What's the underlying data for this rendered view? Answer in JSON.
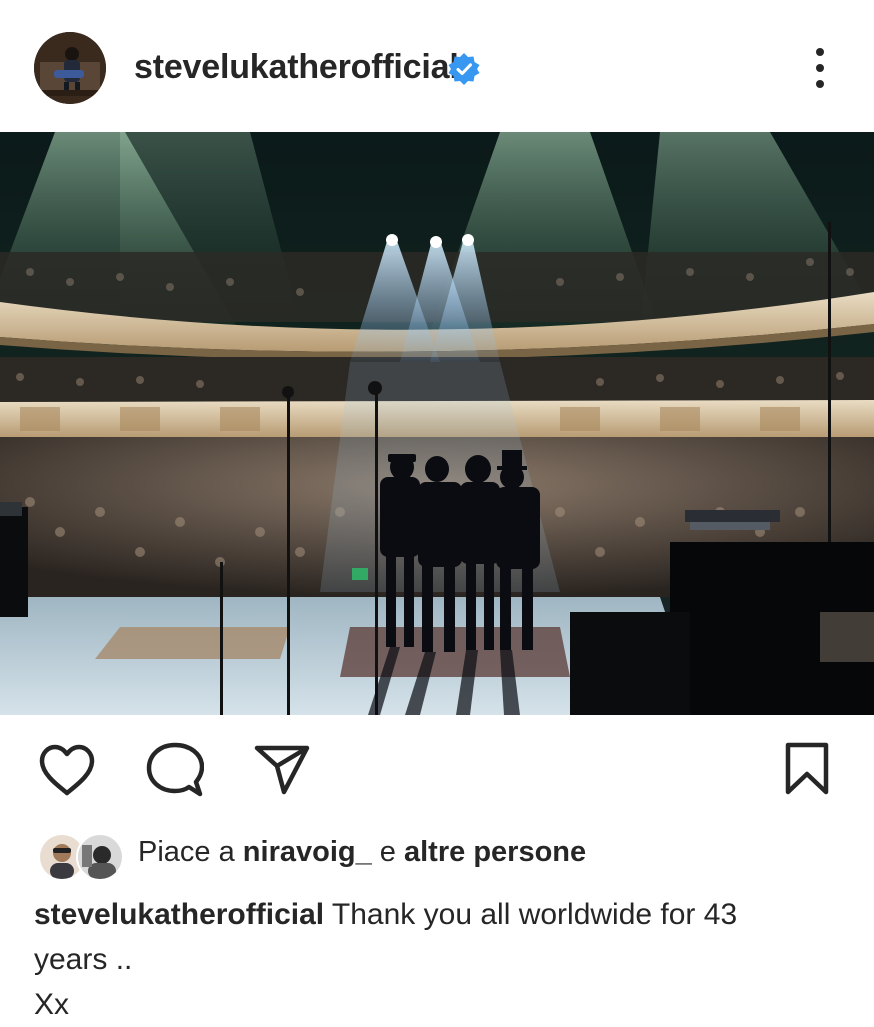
{
  "post": {
    "username": "stevelukatherofficial",
    "verified": true,
    "avatar_icon": "profile-photo-guitarist",
    "more_icon": "more-vertical-icon",
    "image_description_icon": "concert-stage-photo",
    "actions": {
      "like_icon": "heart-icon",
      "comment_icon": "comment-bubble-icon",
      "share_icon": "send-paper-plane-icon",
      "save_icon": "bookmark-icon"
    },
    "likes": {
      "prefix": "Piace a",
      "user": "niravoig_",
      "middle": "e",
      "suffix": "altre persone"
    },
    "caption": {
      "username": "stevelukatherofficial",
      "line1": "Thank you all worldwide for 43",
      "line2": "years ..",
      "line3": "Xx"
    }
  },
  "colors": {
    "text": "#262626",
    "verified_badge": "#3897f0",
    "background": "#ffffff"
  }
}
